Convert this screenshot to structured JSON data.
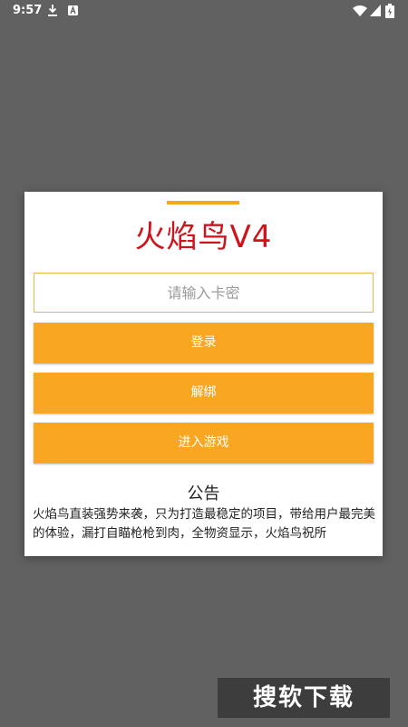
{
  "status_bar": {
    "time": "9:57",
    "icons": [
      "download-icon",
      "a-notification-icon",
      "wifi-icon",
      "signal-icon",
      "battery-icon"
    ]
  },
  "dialog": {
    "title": "火焰鸟V4",
    "card_input": {
      "placeholder": "请输入卡密",
      "value": ""
    },
    "login_button": "登录",
    "unbind_button": "解绑",
    "enter_game_button": "进入游戏",
    "notice_title": "公告",
    "notice_text": "火焰鸟直装强势来袭，只为打造最稳定的项目，带给用户最完美的体验，漏打自瞄枪枪到肉，全物资显示，火焰鸟祝所"
  },
  "watermark": "搜软下载",
  "colors": {
    "accent": "#f9a722",
    "title_red": "#d0121b",
    "backdrop": "#616161"
  }
}
